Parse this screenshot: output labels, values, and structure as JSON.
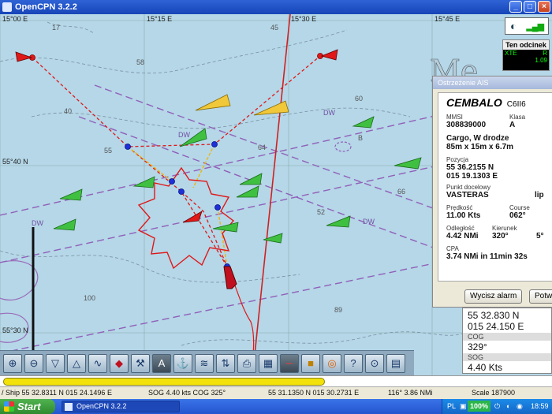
{
  "window": {
    "title": "OpenCPN 3.2.2"
  },
  "chart": {
    "lon_labels": [
      "15°00 E",
      "15°15 E",
      "15°30 E",
      "15°45 E"
    ],
    "lat_labels": [
      "55°40 N",
      "55°30 N"
    ],
    "depths": [
      "17",
      "45",
      "58",
      "40",
      "55",
      "60",
      "64",
      "66",
      "52",
      "100",
      "89",
      "B"
    ],
    "lane_label": "DW",
    "watermark": "Me"
  },
  "compass": {
    "gps_label": "GPS"
  },
  "leg_panel": {
    "title": "Ten odcinek",
    "xte_label": "XTE",
    "xte_unit": "R",
    "xte_value": "1.09"
  },
  "ais": {
    "dialog_title": "Ostrzeżenie AIS",
    "name": "CEMBALO",
    "callsign": "C6II6",
    "mmsi_label": "MMSI",
    "mmsi": "308839000",
    "class_label": "Klasa",
    "class": "A",
    "status": "Cargo, W drodze",
    "dimensions": "85m x 15m x 6.7m",
    "position_label": "Pozycja",
    "lat": "55 36.2155 N",
    "lon": "015 19.1303 E",
    "dest_label": "Punkt docelowy",
    "dest": "VASTERAS",
    "dest_extra": "lip",
    "speed_label": "Prędkość",
    "speed": "11.00 Kts",
    "course_label": "Course",
    "course": "062°",
    "range_label": "Odległość",
    "range": "4.42 NMi",
    "bearing_label": "Kierunek",
    "bearing": "320°",
    "bearing_extra": "5°",
    "cpa_label": "CPA",
    "cpa": "3.74 NMi in 11min 32s",
    "btn_clear": "Wycisz alarm",
    "btn_confirm": "Potw"
  },
  "navdata": {
    "lat": "55 32.830 N",
    "lon": "015 24.150 E",
    "cog_label": "COG",
    "cog": "329°",
    "sog_label": "SOG",
    "sog": "4.40 Kts"
  },
  "progress": {
    "fraction": 0.59
  },
  "status": {
    "ship": "/ Ship 55 32.8311 N   015 24.1496 E",
    "sog": "SOG 4.40 kts  COG 325°",
    "cursor": "55 31.1350 N   015 30.2731 E",
    "brg": "116°  3.86 NMi",
    "scale": "Scale 187900"
  },
  "taskbar": {
    "start": "Start",
    "app": "OpenCPN 3.2.2",
    "lang": "PL",
    "battery": "100%",
    "time": "18:59"
  }
}
